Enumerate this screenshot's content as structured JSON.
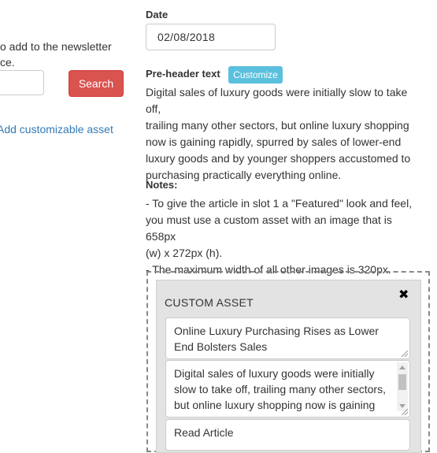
{
  "left": {
    "newsletter_line1": "o add to the newsletter",
    "newsletter_line2": "ce.",
    "search_button": "Search",
    "add_asset_link": "Add customizable asset"
  },
  "date": {
    "label": "Date",
    "value": "02/08/2018"
  },
  "preheader": {
    "label": "Pre-header text",
    "customize_button": "Customize",
    "lines": [
      "Digital sales of luxury goods were initially slow to take off,",
      "trailing many other sectors, but online luxury shopping",
      "now is gaining rapidly, spurred by sales of lower-end",
      "luxury goods and by younger shoppers accustomed to",
      "purchasing practically everything online."
    ]
  },
  "notes": {
    "label": "Notes:",
    "lines": [
      "- To give the article in slot 1 a \"Featured\" look and feel,",
      "you must use a custom asset with an image that is 658px",
      "(w) x 272px (h).",
      "- The maximum width of all other images is 320px."
    ]
  },
  "custom_asset": {
    "title": "CUSTOM ASSET",
    "close_glyph": "✖",
    "headline_lines": [
      "Online Luxury Purchasing Rises as Lower",
      "End Bolsters Sales"
    ],
    "summary_lines": [
      "Digital sales of luxury goods were initially",
      "slow to take off, trailing many other sectors,",
      "but online luxury shopping now is gaining"
    ],
    "link_text": "Read Article"
  },
  "colors": {
    "search_button": "#d9534f",
    "customize_button": "#5bc0de",
    "link": "#337ab7",
    "panel_bg": "#e3e3e3"
  }
}
